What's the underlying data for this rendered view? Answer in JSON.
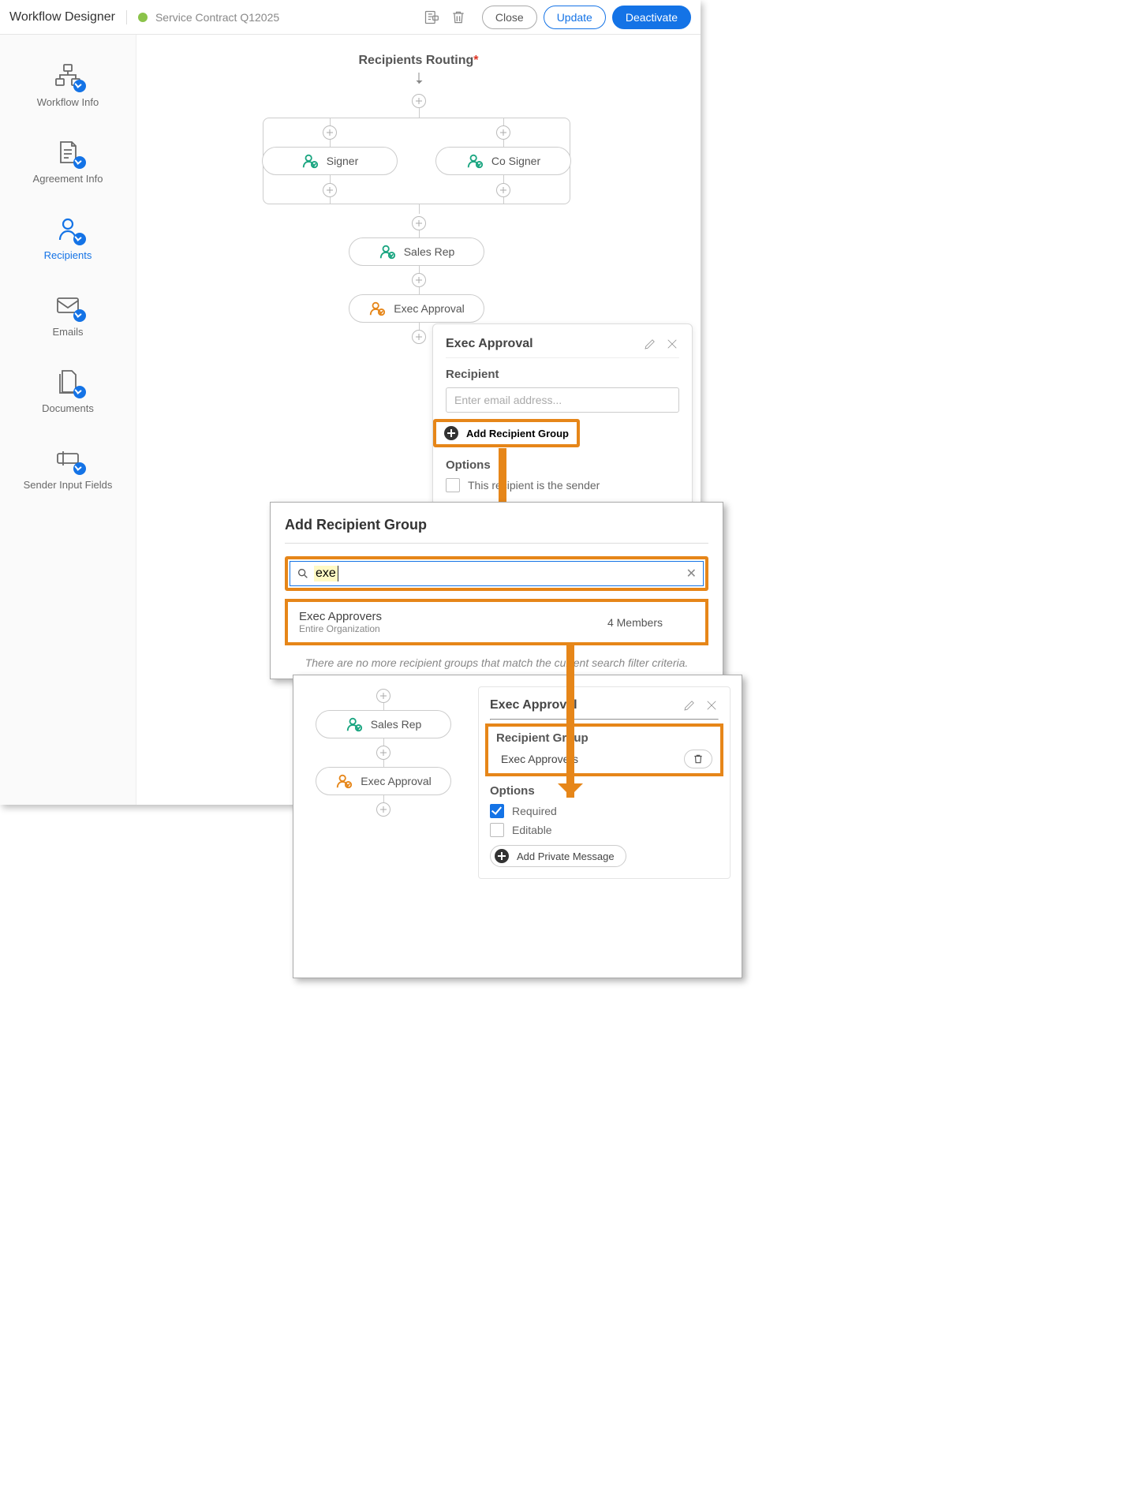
{
  "header": {
    "title": "Workflow Designer",
    "subtitle": "Service Contract Q12025",
    "close": "Close",
    "update": "Update",
    "deactivate": "Deactivate"
  },
  "sidebar": {
    "items": [
      {
        "label": "Workflow Info"
      },
      {
        "label": "Agreement Info"
      },
      {
        "label": "Recipients"
      },
      {
        "label": "Emails"
      },
      {
        "label": "Documents"
      },
      {
        "label": "Sender Input Fields"
      }
    ]
  },
  "route": {
    "title": "Recipients Routing",
    "signer": "Signer",
    "cosigner": "Co Signer",
    "salesrep": "Sales Rep",
    "exec": "Exec Approval"
  },
  "panel1": {
    "title": "Exec Approval",
    "recipient_label": "Recipient",
    "email_placeholder": "Enter email address...",
    "add_group": "Add Recipient Group",
    "options_label": "Options",
    "opt_sender": "This recipient is the sender"
  },
  "modal": {
    "title": "Add Recipient Group",
    "search_value": "exe",
    "result_name": "Exec Approvers",
    "result_sub": "Entire Organization",
    "members": "4 Members",
    "no_more": "There are no more recipient groups that match the current search filter criteria."
  },
  "panel3": {
    "title": "Exec Approval",
    "grp_label": "Recipient Group",
    "grp_value": "Exec Approvers",
    "options_label": "Options",
    "opt_required": "Required",
    "opt_editable": "Editable",
    "add_pm": "Add Private Message"
  }
}
